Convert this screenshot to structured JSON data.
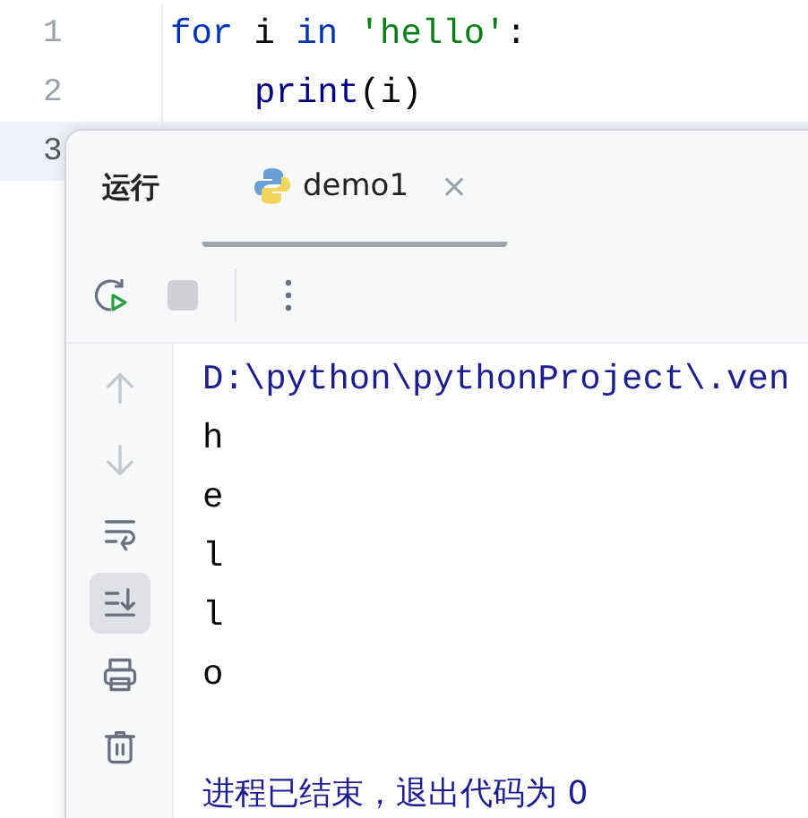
{
  "editor": {
    "lines": [
      {
        "number": "1",
        "current": false,
        "tokens": [
          {
            "text": "for",
            "kind": "keyword"
          },
          {
            "text": " i ",
            "kind": "plain"
          },
          {
            "text": "in",
            "kind": "keyword"
          },
          {
            "text": " 'hello'",
            "kind": "string"
          },
          {
            "text": ":",
            "kind": "plain"
          }
        ]
      },
      {
        "number": "2",
        "current": false,
        "indented": true,
        "tokens": [
          {
            "text": "print",
            "kind": "builtin"
          },
          {
            "text": "(i)",
            "kind": "plain"
          }
        ]
      },
      {
        "number": "3",
        "current": true
      }
    ]
  },
  "run_panel": {
    "title": "运行",
    "tabs": [
      {
        "label": "demo1",
        "selected": true,
        "close": "×"
      }
    ],
    "toolbar": [
      {
        "kind": "rerun"
      },
      {
        "kind": "stop",
        "disabled": true
      },
      {
        "kind": "separator"
      },
      {
        "kind": "more"
      }
    ],
    "side_tools": [
      {
        "disabled": true,
        "selected": false
      },
      {
        "disabled": true,
        "selected": false
      },
      {
        "disabled": false,
        "selected": false
      },
      {
        "disabled": false,
        "selected": true
      },
      {
        "disabled": false,
        "selected": false
      },
      {
        "disabled": false,
        "selected": false
      }
    ],
    "console": [
      {
        "text": "D:\\python\\pythonProject\\.ven",
        "kind": "system"
      },
      {
        "text": "h",
        "kind": "output"
      },
      {
        "text": "e",
        "kind": "output"
      },
      {
        "text": "l",
        "kind": "output"
      },
      {
        "text": "l",
        "kind": "output"
      },
      {
        "text": "o",
        "kind": "output"
      },
      {
        "text": "进程已结束，退出代码为 0",
        "kind": "exit"
      }
    ]
  }
}
